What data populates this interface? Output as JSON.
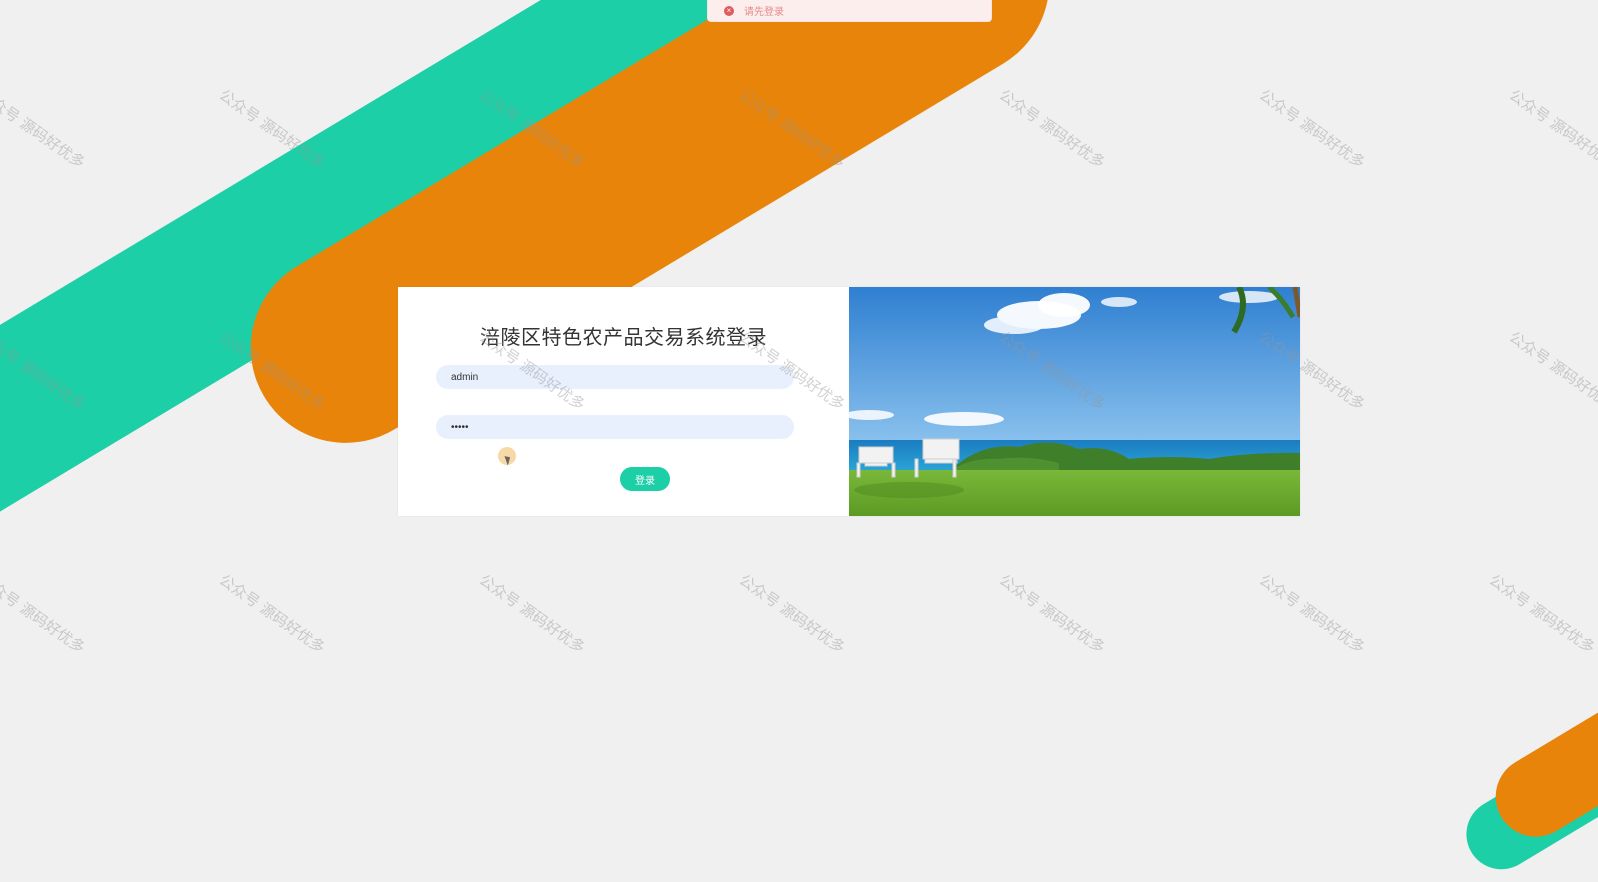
{
  "toast": {
    "icon": "error-circle-icon",
    "message": "请先登录"
  },
  "login": {
    "title": "涪陵区特色农产品交易系统登录",
    "username_value": "admin",
    "password_value": "•••••",
    "submit_label": "登录"
  },
  "watermark": {
    "text": "公众号 源码好优多"
  },
  "colors": {
    "teal": "#1dcfa6",
    "orange": "#e8840a",
    "input_bg": "#e8f0fe",
    "toast_bg": "#fdeeee"
  }
}
